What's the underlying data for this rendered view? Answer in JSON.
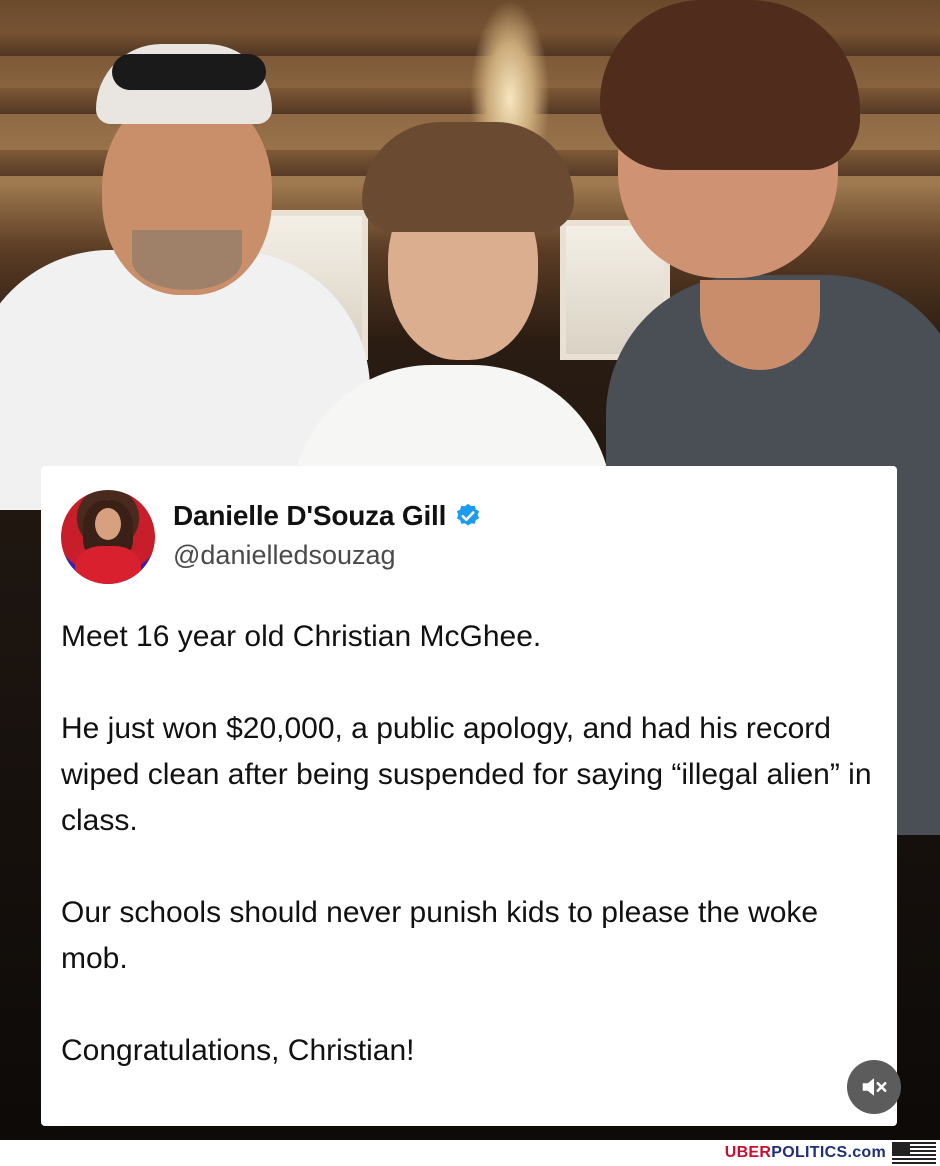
{
  "post": {
    "author_name": "Danielle D'Souza Gill",
    "handle": "@danielledsouzag",
    "verified_icon": "verified-badge-icon",
    "paragraphs": [
      "Meet 16 year old Christian McGhee.",
      "He just won $20,000, a public apology, and had his record wiped clean after being suspended for saying “illegal alien” in class.",
      "Our schools should never punish kids to please the woke mob.",
      "Congratulations, Christian!"
    ]
  },
  "controls": {
    "mute_icon": "speaker-muted-icon"
  },
  "watermark": {
    "prefix": "UBER",
    "suffix": "POLITICS.com"
  },
  "colors": {
    "verified": "#1d9bf0",
    "brand_red": "#c8102e",
    "brand_blue": "#1f2d7a"
  }
}
